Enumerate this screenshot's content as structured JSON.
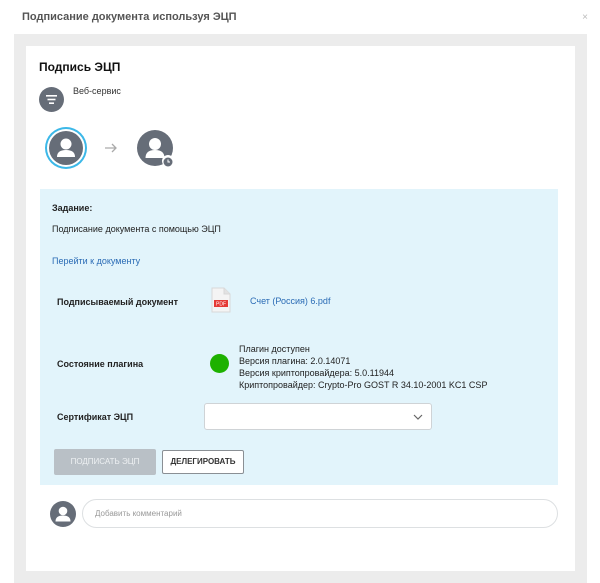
{
  "modal": {
    "title": "Подписание документа используя ЭЦП",
    "close_glyph": "×"
  },
  "card": {
    "title": "Подпись ЭЦП",
    "service_label": "Веб-сервис"
  },
  "task": {
    "label": "Задание:",
    "text": "Подписание документа с помощью ЭЦП",
    "link": "Перейти к документу"
  },
  "document": {
    "label": "Подписываемый документ",
    "file_name": "Счет (Россия) 6.pdf",
    "file_badge": "PDF"
  },
  "plugin": {
    "label": "Состояние плагина",
    "status_color": "#1db100",
    "lines": [
      "Плагин доступен",
      "Версия плагина: 2.0.14071",
      "Версия криптопровайдера: 5.0.11944",
      "Криптопровайдер: Crypto-Pro GOST R 34.10-2001 KC1 CSP"
    ]
  },
  "certificate": {
    "label": "Сертификат ЭЦП",
    "selected": ""
  },
  "buttons": {
    "sign": "ПОДПИСАТЬ ЭЦП",
    "delegate": "ДЕЛЕГИРОВАТЬ"
  },
  "comment": {
    "placeholder": "Добавить комментарий"
  },
  "colors": {
    "accent": "#3cb8e8",
    "link": "#2a6bb5",
    "panel": "#e2f4fb",
    "avatar": "#666d78"
  },
  "icons": {
    "close": "close-icon",
    "service": "list-lines-icon",
    "step_current": "user-avatar-icon",
    "arrow": "arrow-right-icon",
    "step_next": "user-clock-icon",
    "file": "pdf-file-icon",
    "status": "status-dot-icon",
    "dropdown": "chevron-down-icon",
    "comment_user": "user-avatar-icon"
  }
}
